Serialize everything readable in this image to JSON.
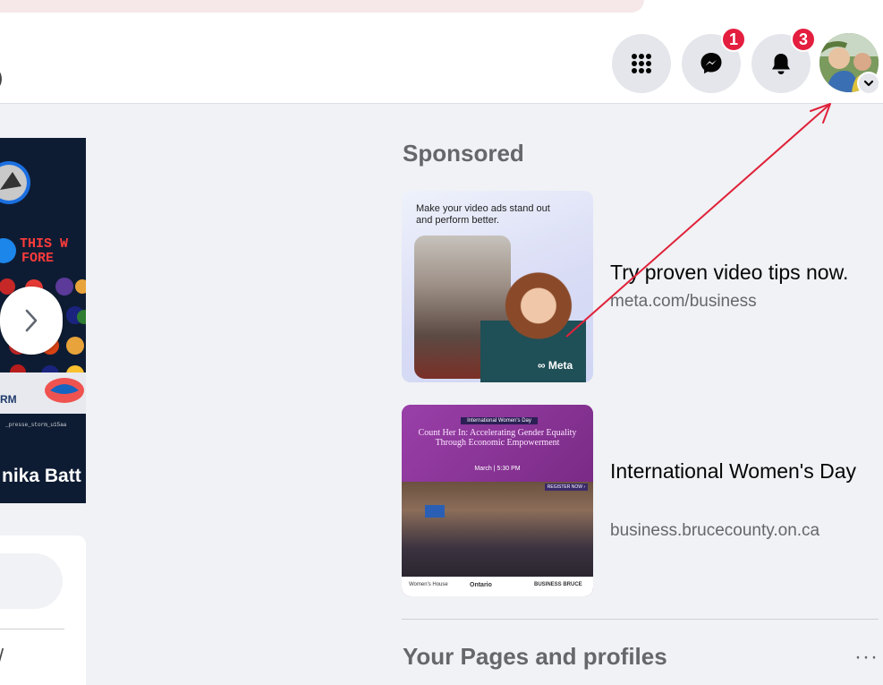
{
  "header": {
    "partial_text": ")",
    "menu_icon": "grid-icon",
    "messenger": {
      "icon": "messenger-icon",
      "badge": "1"
    },
    "notifications": {
      "icon": "bell-icon",
      "badge": "3"
    },
    "account": {
      "icon": "chevron-down-icon"
    }
  },
  "left": {
    "card_banner": "THIS W FORE",
    "card_caption": "_presse_storm_u15aa",
    "card_name": "nika Batt",
    "partial_text": "/"
  },
  "right": {
    "sponsored_heading": "Sponsored",
    "ads": [
      {
        "title": "Try proven video tips now.",
        "url": "meta.com/business",
        "image_caption": "Make your video ads stand out and perform better.",
        "image_logo": "∞ Meta"
      },
      {
        "title": "International Women's Day",
        "url": "business.brucecounty.on.ca",
        "image_tag": "International Women's Day",
        "image_headline": "Count Her In: Accelerating Gender Equality Through Economic Empowerment",
        "image_date": "March | 5:30 PM",
        "image_register": "REGISTER NOW ›",
        "image_footer_1": "Women's House",
        "image_footer_2": "Ontario",
        "image_footer_3": "BUSINESS BRUCE"
      }
    ],
    "pages_heading": "Your Pages and profiles",
    "more_label": "···"
  },
  "colors": {
    "badge": "#e41e3f",
    "annotation": "#e0223a",
    "background": "#f0f2f5"
  }
}
